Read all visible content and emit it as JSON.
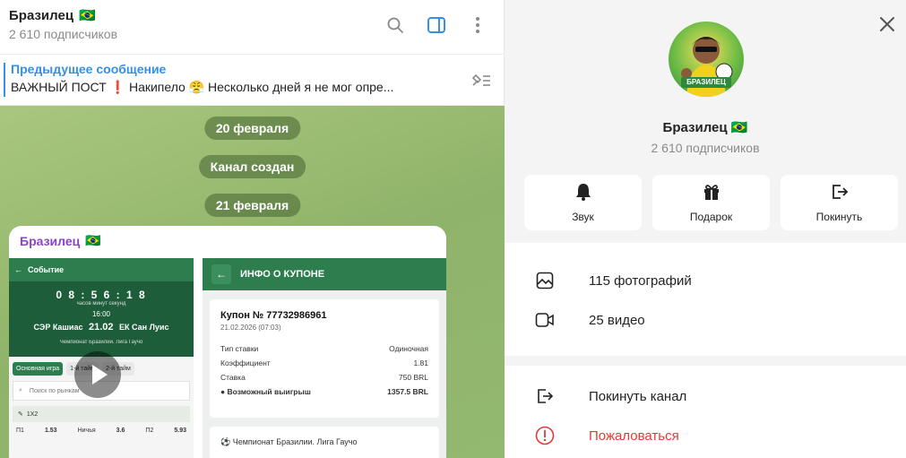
{
  "chat": {
    "title": "Бразилец",
    "flag": "🇧🇷",
    "subscribers": "2 610 подписчиков",
    "icons": [
      "search-icon",
      "sidebar-toggle-icon",
      "more-vertical-icon"
    ]
  },
  "pinned": {
    "title": "Предыдущее сообщение",
    "text": "ВАЖНЫЙ ПОСТ ❗ Накипело 😤 Несколько дней я не мог опре..."
  },
  "service": {
    "date1": "20 февраля",
    "created": "Канал создан",
    "date2": "21 февраля"
  },
  "message": {
    "author": "Бразилец",
    "left_shot": {
      "header": "Событие",
      "time": "0 8 : 5 6 : 1 8",
      "time_labels": "часов минут секунд",
      "clock": "16:00",
      "team1": "СЭР Кашиас",
      "date": "21.02",
      "team2": "ЕК Сан Луис",
      "league": "Чемпионат Бразилии. Лига Гаучо",
      "tabs": [
        "Основная игра",
        "1-й тайм",
        "2-й тайм"
      ],
      "search_placeholder": "Поиск по рынкам",
      "market": "1X2",
      "odds": [
        "П1",
        "1.53",
        "Ничья",
        "3.6",
        "П2",
        "5.93"
      ]
    },
    "right_shot": {
      "header": "ИНФО О КУПОНЕ",
      "coupon": "Купон № 77732986961",
      "coupon_date": "21.02.2026 (07:03)",
      "rows": [
        {
          "k": "Тип ставки",
          "v": "Одиночная"
        },
        {
          "k": "Коэффициент",
          "v": "1.81"
        },
        {
          "k": "Ставка",
          "v": "750 BRL"
        },
        {
          "k": "Возможный выигрыш",
          "v": "1357.5 BRL"
        }
      ],
      "league": "Чемпионат Бразилии. Лига Гаучо"
    }
  },
  "panel": {
    "name": "Бразилец",
    "flag": "🇧🇷",
    "subscribers": "2 610 подписчиков",
    "avatar_text": "БРАЗИЛЕЦ",
    "actions": [
      {
        "label": "Звук",
        "icon": "bell-icon"
      },
      {
        "label": "Подарок",
        "icon": "gift-icon"
      },
      {
        "label": "Покинуть",
        "icon": "logout-icon"
      }
    ],
    "media": [
      {
        "label": "115 фотографий",
        "icon": "photo-icon"
      },
      {
        "label": "25 видео",
        "icon": "video-icon"
      }
    ],
    "leave": "Покинуть канал",
    "report": "Пожаловаться",
    "danger_color": "#e53935"
  }
}
